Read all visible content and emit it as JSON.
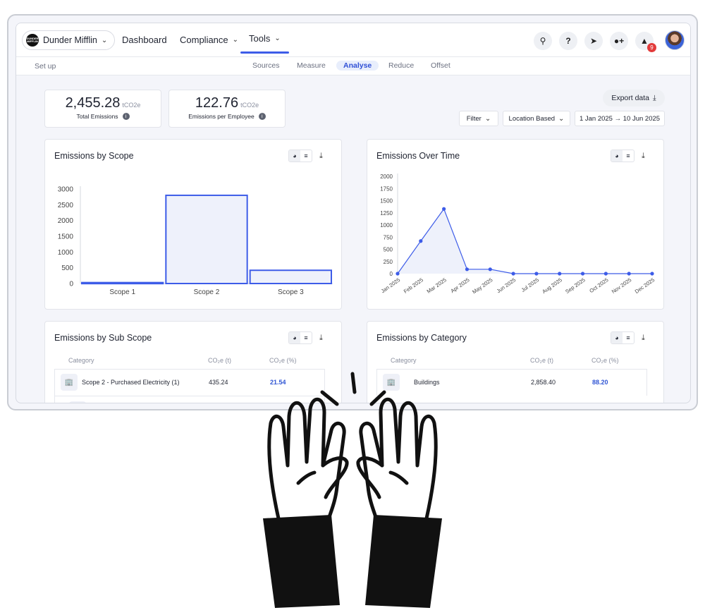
{
  "org": {
    "name": "Dunder Mifflin",
    "logo_text": "DUNDER MIFFLIN"
  },
  "nav": {
    "dashboard": "Dashboard",
    "compliance": "Compliance",
    "tools": "Tools"
  },
  "header_icons": {
    "notification_count": "9"
  },
  "subnav": {
    "setup": "Set up",
    "tabs": [
      "Sources",
      "Measure",
      "Analyse",
      "Reduce",
      "Offset"
    ],
    "active": "Analyse"
  },
  "kpis": [
    {
      "value": "2,455.28",
      "unit": "tCO2e",
      "label": "Total Emissions"
    },
    {
      "value": "122.76",
      "unit": "tCO2e",
      "label": "Emissions per Employee"
    }
  ],
  "controls": {
    "export": "Export data",
    "filter": "Filter",
    "basis": "Location Based",
    "date_range": "1 Jan 2025 → 10 Jun 2025"
  },
  "panels": {
    "scope": "Emissions by Scope",
    "time": "Emissions Over Time",
    "subscope": "Emissions by Sub Scope",
    "category": "Emissions by Category"
  },
  "subscope_table": {
    "headers": [
      "Category",
      "CO₂e (t)",
      "CO₂e (%)"
    ],
    "rows": [
      {
        "category": "Scope 2 - Purchased Electricity (1)",
        "co2e": "435.24",
        "pct": "21.54"
      }
    ]
  },
  "category_table": {
    "headers": [
      "Category",
      "CO₂e (t)",
      "CO₂e (%)"
    ],
    "rows": [
      {
        "category": "Buildings",
        "co2e": "2,858.40",
        "pct": "88.20"
      }
    ]
  },
  "chart_data": [
    {
      "type": "bar",
      "title": "Emissions by Scope",
      "categories": [
        "Scope 1",
        "Scope 2",
        "Scope 3"
      ],
      "values": [
        30,
        2800,
        420
      ],
      "ylim": [
        0,
        3000
      ],
      "yticks": [
        0,
        500,
        1000,
        1500,
        2000,
        2500,
        3000
      ],
      "color": "#3d5ce8",
      "grid": false
    },
    {
      "type": "area",
      "title": "Emissions Over Time",
      "categories": [
        "Jan 2025",
        "Feb 2025",
        "Mar 2025",
        "Apr 2025",
        "May 2025",
        "Jun 2025",
        "Jul 2025",
        "Aug 2025",
        "Sep 2025",
        "Oct 2025",
        "Nov 2025",
        "Dec 2025"
      ],
      "values": [
        0,
        670,
        1330,
        90,
        90,
        0,
        0,
        0,
        0,
        0,
        0,
        0
      ],
      "ylim": [
        0,
        2000
      ],
      "yticks": [
        0,
        250,
        500,
        750,
        1000,
        1250,
        1500,
        1750,
        2000
      ],
      "color": "#3d5ce8",
      "grid": false
    }
  ]
}
